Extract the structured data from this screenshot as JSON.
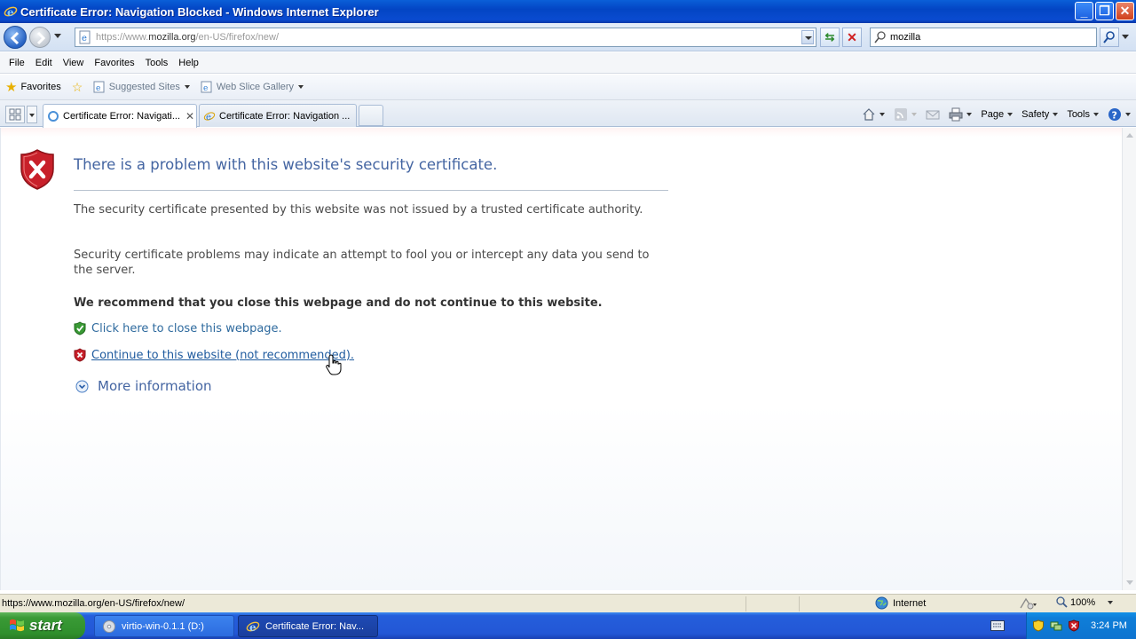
{
  "window": {
    "title": "Certificate Error: Navigation Blocked - Windows Internet Explorer"
  },
  "address": {
    "url_prefix": "https://www.",
    "url_domain": "mozilla.org",
    "url_path": "/en-US/firefox/new/"
  },
  "search": {
    "value": "mozilla"
  },
  "menu": [
    "File",
    "Edit",
    "View",
    "Favorites",
    "Tools",
    "Help"
  ],
  "favorites_bar": {
    "favorites_label": "Favorites",
    "suggested_sites": "Suggested Sites",
    "web_slice_gallery": "Web Slice Gallery"
  },
  "tabs": [
    {
      "label": "Certificate Error: Navigati...",
      "active": true
    },
    {
      "label": "Certificate Error: Navigation ...",
      "active": false
    }
  ],
  "command_bar": {
    "page": "Page",
    "safety": "Safety",
    "tools": "Tools"
  },
  "content": {
    "title": "There is a problem with this website's security certificate.",
    "para1": "The security certificate presented by this website was not issued by a trusted certificate authority.",
    "para2": "Security certificate problems may indicate an attempt to fool you or intercept any data you send to the server.",
    "recommend": "We recommend that you close this webpage and do not continue to this website.",
    "close_link": "Click here to close this webpage.",
    "continue_link": "Continue to this website (not recommended).",
    "more_info": "More information"
  },
  "status": {
    "text": "https://www.mozilla.org/en-US/firefox/new/",
    "zone": "Internet",
    "zoom": "100%"
  },
  "taskbar": {
    "start": "start",
    "tasks": [
      "virtio-win-0.1.1 (D:)",
      "Certificate Error: Nav..."
    ],
    "clock": "3:24 PM"
  },
  "colors": {
    "title_blue": "#4465a2",
    "link_blue": "#1e5a9e",
    "shield_red": "#c8202a",
    "shield_green": "#3a9a36"
  }
}
